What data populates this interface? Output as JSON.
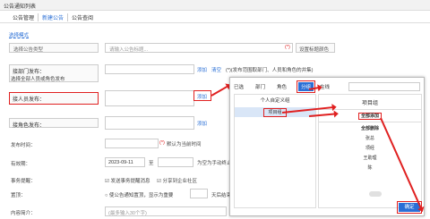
{
  "window": {
    "title": "公告通知列表"
  },
  "tabs": [
    "公告管理",
    "新建公告",
    "公告查阅"
  ],
  "filter_link": "选择模式",
  "form": {
    "type_select": "选择公告类型",
    "title_placeholder": "请输入公告标题...",
    "title_hint": "(*)",
    "set_label": "设置标题颜色",
    "dept_label": "接部门发布：",
    "dept_add": "添加",
    "dept_clear": "清空",
    "dept_hint": "(*)(发布范围取部门、人员和角色的并集)",
    "dept_select_all": "选择全部人员或角色发布",
    "person_label": "接人员发布：",
    "person_add": "添加",
    "role_label": "接角色发布：",
    "role_add": "添加",
    "time_label": "发布时间：",
    "time_hint": "(*)",
    "time_note": "默认为当前时间",
    "valid_label": "有效期：",
    "valid_from": "2023-09-11",
    "valid_to": "至",
    "valid_hint": "为空为手动终止",
    "remind_label": "事务提醒：",
    "remind_opt1": "发送事务提醒消息",
    "remind_opt2": "分享到企业社区",
    "top_label": "置顶：",
    "top_opt": "使公告通知置顶，显示为重要",
    "top_suffix": "天后结束",
    "summary_label": "内容简介：",
    "summary_placeholder": "(最多输入30个字)"
  },
  "modal": {
    "tabs": [
      "已选",
      "部门",
      "角色",
      "分组"
    ],
    "active_tab": "分组",
    "online": "在线",
    "left_title": "个人自定义组",
    "left_item": "项目组",
    "right_title": "项目组",
    "select_all": "全部添加",
    "remove_all": "全部删除",
    "people": [
      "张总",
      "项经",
      "王助理",
      "陈"
    ],
    "ok": "确定"
  },
  "colors": {
    "accent": "#2a6fd6",
    "highlight": "#e02020"
  }
}
